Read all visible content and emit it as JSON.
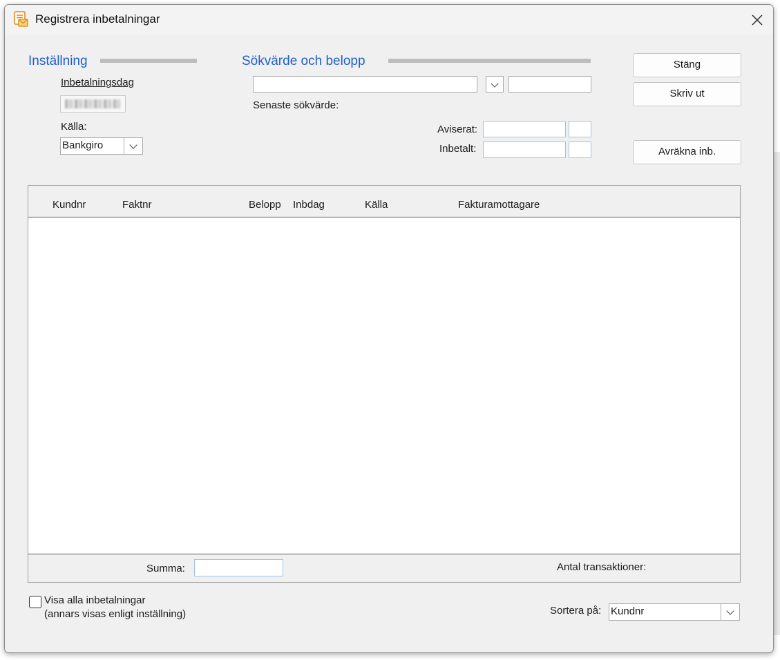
{
  "window": {
    "title": "Registrera inbetalningar",
    "close_glyph": "✕"
  },
  "settings": {
    "section_title": "Inställning",
    "date_label": "Inbetalningsdag",
    "source_label": "Källa:",
    "source_value": "Bankgiro"
  },
  "search": {
    "section_title": "Sökvärde och belopp",
    "search_value": "",
    "amount_value": "",
    "last_search_label": "Senaste sökvärde:",
    "notified_label": "Aviserat:",
    "paid_label": "Inbetalt:"
  },
  "buttons": {
    "close": "Stäng",
    "print": "Skriv ut",
    "settle": "Avräkna inb."
  },
  "table": {
    "columns": [
      "Kundnr",
      "Faktnr",
      "Belopp",
      "Inbdag",
      "Källa",
      "Fakturamottagare"
    ],
    "rows": []
  },
  "footer": {
    "sum_label": "Summa:",
    "sum_value": "",
    "transactions_label": "Antal transaktioner:"
  },
  "options": {
    "show_all_label": "Visa alla inbetalningar",
    "show_all_note": "(annars visas enligt inställning)",
    "show_all_checked": false,
    "sort_label": "Sortera på:",
    "sort_value": "Kundnr"
  },
  "colors": {
    "section_title": "#1f5fd1",
    "window_bg": "#f0f0f0"
  }
}
